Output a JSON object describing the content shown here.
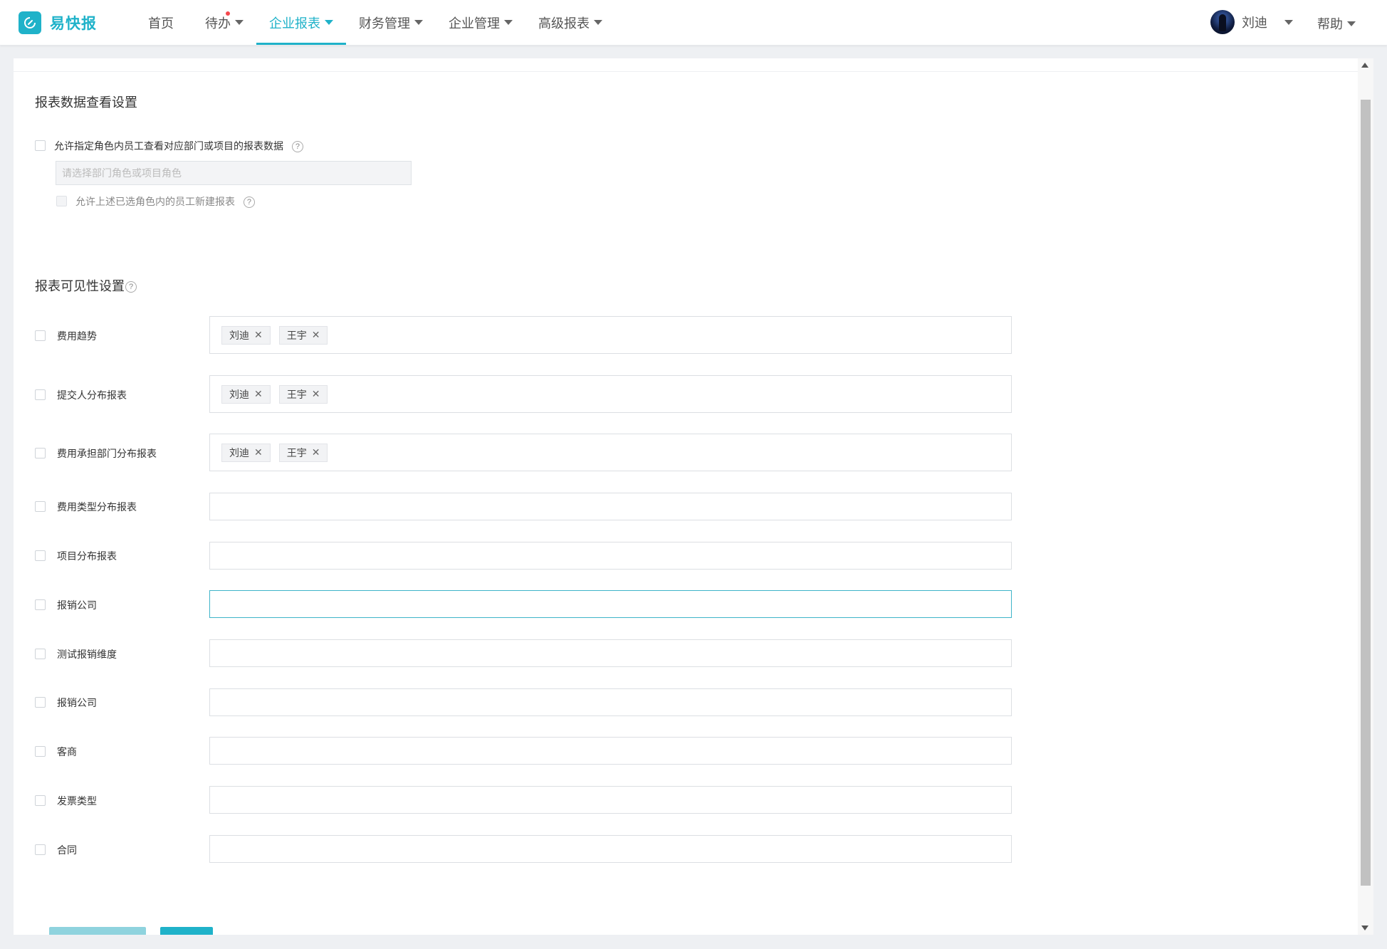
{
  "app": {
    "name": "易快报"
  },
  "nav": {
    "items": [
      {
        "label": "首页"
      },
      {
        "label": "待办"
      },
      {
        "label": "企业报表"
      },
      {
        "label": "财务管理"
      },
      {
        "label": "企业管理"
      },
      {
        "label": "高级报表"
      }
    ],
    "active": "企业报表"
  },
  "user": {
    "name": "刘迪"
  },
  "help": {
    "label": "帮助"
  },
  "data_view": {
    "title": "报表数据查看设置",
    "allow_role_label": "允许指定角色内员工查看对应部门或项目的报表数据",
    "role_placeholder": "请选择部门角色或项目角色",
    "allow_new_label": "允许上述已选角色内的员工新建报表"
  },
  "visibility": {
    "title": "报表可见性设置",
    "rows": [
      {
        "label": "费用趋势",
        "tags": [
          "刘迪",
          "王宇"
        ]
      },
      {
        "label": "提交人分布报表",
        "tags": [
          "刘迪",
          "王宇"
        ]
      },
      {
        "label": "费用承担部门分布报表",
        "tags": [
          "刘迪",
          "王宇"
        ]
      },
      {
        "label": "费用类型分布报表",
        "tags": []
      },
      {
        "label": "项目分布报表",
        "tags": []
      },
      {
        "label": "报销公司",
        "tags": [],
        "focused": true
      },
      {
        "label": "测试报销维度",
        "tags": []
      },
      {
        "label": "报销公司",
        "tags": []
      },
      {
        "label": "客商",
        "tags": []
      },
      {
        "label": "发票类型",
        "tags": []
      },
      {
        "label": "合同",
        "tags": []
      }
    ]
  },
  "colors": {
    "brand": "#1fb2c9",
    "notification_dot": "#f5484d",
    "focus_border": "#3fb4c9"
  }
}
